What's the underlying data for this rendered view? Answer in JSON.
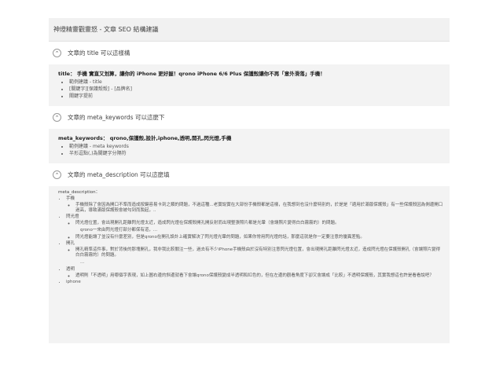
{
  "header": {
    "title": "神燈精靈觀靈怒 - 文章 SEO 結構建議"
  },
  "sections": {
    "title": {
      "heading": "文章的 title 可以這樣構",
      "key": "title：",
      "value": "手機 實直又划算，讓你的 iPhone 更好握！qrono iPhone 6/6 Plus 保護殼讓你不再「意外滑落」手機！",
      "bullets": [
        "範例建議 - title",
        "[關鍵字][保護殼殼] - [品牌名]",
        "關鍵字提前"
      ]
    },
    "keywords": {
      "heading": "文章的 meta_keywords 可以這麼下",
      "key": "meta_keywords：",
      "value": "qrono,保護殼,設計,iphone,透明,開孔,閃光燈,手機",
      "bullets": [
        "範例建議 - meta keywords",
        "半形逗點(,)為關鍵字分隔符"
      ]
    },
    "description": {
      "heading": "文章的 meta_description 可以這麼填",
      "label": "meta_description：",
      "items": [
        {
          "name": "手機",
          "sub": [
            "手機殼除了會因為開口不準而造成按鍵容易卡到之類的問題，不過這種...老實說實在大部份手機殼都是這樣，在我想到也沒什麼特別的，於是是「適用於滿版保護殼」有一些保護殼因為側邊開口過高，導致滿版保護殼會被勾到而脫起，.."
          ]
        },
        {
          "name": "閃光燈",
          "sub": [
            "閃光燈位置，會出現開孔距離閃光燈太近，造成閃光燈在保護殼開孔開反射而出現整張照片都是光暈（會讓照片變得白白霧霧的）的問題。",
            "qrono一來由閃光燈打部分都保有道，...",
            "閃光燈能讓了並沒有什麼差別，但是qrono在開孔設計上確實解決了閃光燈光暈的問題，如果你常用閃光燈的話，那麼這就是你一定要注意的優異差點。"
          ]
        },
        {
          "name": "開孔",
          "sub": [
            "開孔精準這件事，對於背後的那塊開孔，我非我比較關注一些，過去有不少iPhone手機殼由於沒有特別注意閃光燈位置，會出現開孔距離閃光燈太近，造成閃光燈在保護殼開孔（會讓照片變得白白霧霧的）的問題。",
            "..."
          ]
        },
        {
          "name": "透明",
          "sub": [
            "透明則「不透明」用哪個字表現，如上圖右邊的斜邊就看下會讓qrono保護殼變成半透明和紅色的，但在左邊的觀看角度下卻又會讓成「比較」不透明保護殼，其實我想這也許是看看說吧？"
          ]
        },
        {
          "name": "iphone",
          "sub": []
        }
      ]
    }
  },
  "icons": {
    "toggle": "collapse-circle-icon"
  }
}
